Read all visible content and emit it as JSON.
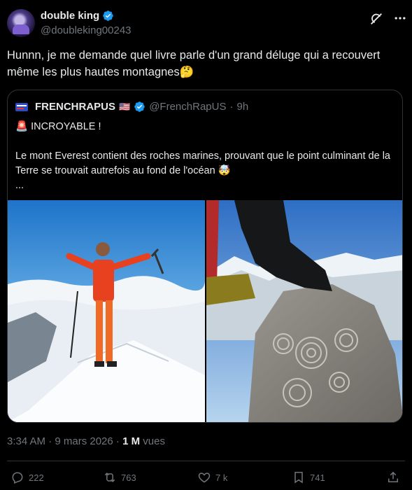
{
  "author": {
    "display_name": "double king",
    "handle": "@doubleking00243"
  },
  "tweet": {
    "text": "Hunnn, je me demande quel livre parle d'un grand déluge qui a recouvert même les plus hautes montagnes🤔"
  },
  "quoted": {
    "display_name": "FRENCHRAPUS",
    "flag": "🇺🇸",
    "handle": "@FrenchRapUS",
    "separator": "·",
    "time": "9h",
    "line1": "🚨 INCROYABLE !",
    "line2": "Le mont Everest contient des roches marines, prouvant que le point culminant de la Terre se trouvait autrefois au fond de l'océan 🤯",
    "line3": "..."
  },
  "meta": {
    "time": "3:34 AM · 9 mars 2026 · ",
    "views_count": "1 M",
    "views_label": " vues"
  },
  "actions": {
    "replies": "222",
    "reposts": "763",
    "likes": "7 k",
    "bookmarks": "741"
  },
  "colors": {
    "verified": "#1d9bf0",
    "muted": "#71767b",
    "text": "#e7e9ea",
    "border": "#2f3336"
  },
  "icons": [
    "verified-badge-icon",
    "grok-icon",
    "more-icon",
    "reply-icon",
    "repost-icon",
    "like-icon",
    "bookmark-icon",
    "share-icon"
  ]
}
